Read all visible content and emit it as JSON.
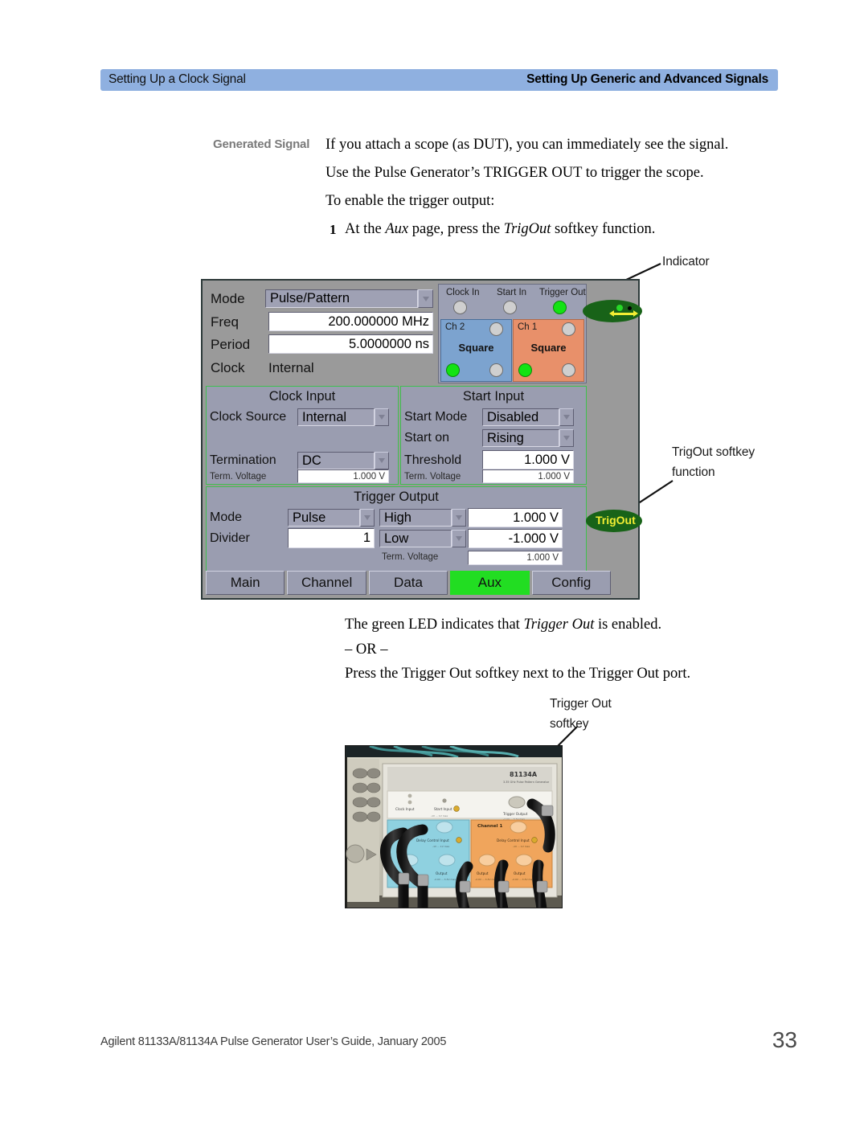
{
  "header": {
    "left_title": "Setting Up a Clock Signal",
    "right_title": "Setting Up Generic and Advanced Signals",
    "band_color": "#8fb0e0"
  },
  "body": {
    "side_label": "Generated Signal",
    "paragraph_1": "If you attach a scope (as DUT), you can immediately see the signal.",
    "paragraph_2": "Use the Pulse Generator’s TRIGGER OUT to trigger the scope.",
    "paragraph_3": "To enable the trigger output:",
    "step_1_number": "1",
    "step_1_pre": "At the ",
    "step_1_italic_1": "Aux",
    "step_1_mid": " page, press the ",
    "step_1_italic_2": "TrigOut",
    "step_1_post": " softkey function.",
    "after_1": "The green LED indicates that ",
    "after_1_italic": "Trigger Out",
    "after_1_post": " is enabled.",
    "or_line": "– OR –",
    "after_2": "Press the Trigger Out softkey next to the Trigger Out port."
  },
  "callouts": {
    "indicator": "Indicator",
    "trigout_softkey_line1": "TrigOut softkey",
    "trigout_softkey_line2": "function",
    "trigger_out_softkey_line1": "Trigger Out",
    "trigger_out_softkey_line2": "softkey"
  },
  "instrument": {
    "top_settings": [
      {
        "label": "Mode",
        "value": "Pulse/Pattern",
        "type": "combo"
      },
      {
        "label": "Freq",
        "value": "200.000000 MHz",
        "type": "numeric"
      },
      {
        "label": "Period",
        "value": "5.0000000 ns",
        "type": "numeric"
      },
      {
        "label": "Clock",
        "value": "Internal",
        "type": "static"
      }
    ],
    "connector_panel": {
      "top_ports": [
        {
          "label": "Clock In",
          "led": "gray"
        },
        {
          "label": "Start In",
          "led": "gray"
        },
        {
          "label": "Trigger Out",
          "led": "green"
        }
      ],
      "channels": [
        {
          "name": "Ch 2",
          "waveform": "Square",
          "color": "#7ca3cf"
        },
        {
          "name": "Ch 1",
          "waveform": "Square",
          "color": "#e8906a"
        }
      ]
    },
    "clock_input": {
      "title": "Clock Input",
      "source_label": "Clock Source",
      "source_value": "Internal",
      "termination_label": "Termination",
      "termination_value": "DC",
      "term_voltage_label": "Term. Voltage",
      "term_voltage_value": "1.000 V"
    },
    "start_input": {
      "title": "Start Input",
      "start_mode_label": "Start Mode",
      "start_mode_value": "Disabled",
      "start_on_label": "Start on",
      "start_on_value": "Rising",
      "threshold_label": "Threshold",
      "threshold_value": "1.000 V",
      "term_voltage_label": "Term. Voltage",
      "term_voltage_value": "1.000 V"
    },
    "trigger_output": {
      "title": "Trigger Output",
      "mode_label": "Mode",
      "mode_value": "Pulse",
      "divider_label": "Divider",
      "divider_value": "1",
      "high_label": "High",
      "high_value": "1.000 V",
      "low_label": "Low",
      "low_value": "-1.000 V",
      "term_voltage_label": "Term. Voltage",
      "term_voltage_value": "1.000 V"
    },
    "softkeys": {
      "indicator_name": "indicator-led",
      "trigout_label": "TrigOut"
    },
    "tabs": [
      {
        "label": "Main",
        "active": false
      },
      {
        "label": "Channel",
        "active": false
      },
      {
        "label": "Data",
        "active": false
      },
      {
        "label": "Aux",
        "active": true
      },
      {
        "label": "Config",
        "active": false
      }
    ],
    "active_tab_color": "#22dd22"
  },
  "photo": {
    "model_label": "81134A",
    "model_sub": "3.35 GHz Pulse Pattern Generator",
    "port_labels": [
      "Clock Input",
      "Start Input",
      "Trigger Out"
    ],
    "channel1_label": "Channel 1",
    "delay_label": "Delay Control Input",
    "output_label": "Output"
  },
  "footer": {
    "text": "Agilent 81133A/81134A Pulse Generator User’s Guide, January 2005",
    "page": "33"
  }
}
